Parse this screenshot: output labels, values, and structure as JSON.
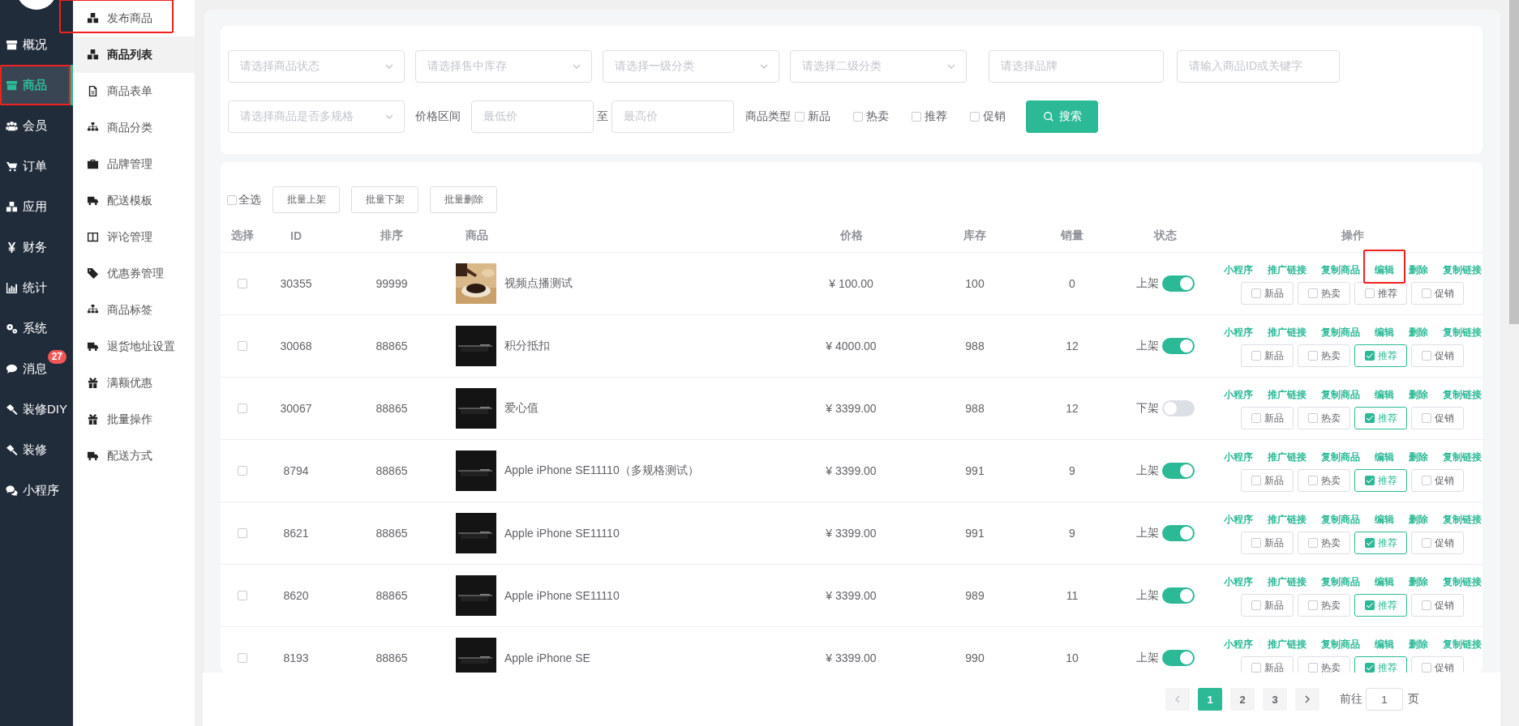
{
  "sidebar": {
    "items": [
      {
        "label": "概况",
        "selected": false,
        "annotated": false
      },
      {
        "label": "商品",
        "selected": true,
        "annotated": true
      },
      {
        "label": "会员",
        "selected": false,
        "annotated": false
      },
      {
        "label": "订单",
        "selected": false,
        "annotated": false
      },
      {
        "label": "应用",
        "selected": false,
        "annotated": false
      },
      {
        "label": "财务",
        "selected": false,
        "annotated": false
      },
      {
        "label": "统计",
        "selected": false,
        "annotated": false
      },
      {
        "label": "系统",
        "selected": false,
        "annotated": false
      },
      {
        "label": "消息",
        "selected": false,
        "annotated": false,
        "badge": "27"
      },
      {
        "label": "装修DIY",
        "selected": false,
        "annotated": false
      },
      {
        "label": "装修",
        "selected": false,
        "annotated": false
      },
      {
        "label": "小程序",
        "selected": false,
        "annotated": false
      }
    ]
  },
  "submenu": {
    "items": [
      {
        "label": "发布商品",
        "selected": false,
        "annotated": true
      },
      {
        "label": "商品列表",
        "selected": true,
        "annotated": false
      },
      {
        "label": "商品表单",
        "selected": false,
        "annotated": false
      },
      {
        "label": "商品分类",
        "selected": false,
        "annotated": false
      },
      {
        "label": "品牌管理",
        "selected": false,
        "annotated": false
      },
      {
        "label": "配送模板",
        "selected": false,
        "annotated": false
      },
      {
        "label": "评论管理",
        "selected": false,
        "annotated": false
      },
      {
        "label": "优惠券管理",
        "selected": false,
        "annotated": false
      },
      {
        "label": "商品标签",
        "selected": false,
        "annotated": false
      },
      {
        "label": "退货地址设置",
        "selected": false,
        "annotated": false
      },
      {
        "label": "满额优惠",
        "selected": false,
        "annotated": false
      },
      {
        "label": "批量操作",
        "selected": false,
        "annotated": false
      },
      {
        "label": "配送方式",
        "selected": false,
        "annotated": false
      }
    ]
  },
  "filters": {
    "fields": [
      {
        "kind": "select",
        "placeholder": "请选择商品状态"
      },
      {
        "kind": "select",
        "placeholder": "请选择售中库存"
      },
      {
        "kind": "select",
        "placeholder": "请选择一级分类"
      },
      {
        "kind": "select",
        "placeholder": "请选择二级分类"
      },
      {
        "kind": "input",
        "placeholder": "请选择品牌"
      },
      {
        "kind": "input",
        "placeholder": "请输入商品ID或关键字"
      }
    ],
    "spec_select": {
      "placeholder": "请选择商品是否多规格"
    },
    "price_label": "价格区间",
    "min_placeholder": "最低价",
    "separator": "至",
    "max_placeholder": "最高价",
    "type_label": "商品类型",
    "types": [
      {
        "label": "新品",
        "checked": false
      },
      {
        "label": "热卖",
        "checked": false
      },
      {
        "label": "推荐",
        "checked": false
      },
      {
        "label": "促销",
        "checked": false
      }
    ],
    "search_button": "搜索"
  },
  "bulk": {
    "select_all": {
      "label": "全选",
      "checked": false
    },
    "buttons": [
      "批量上架",
      "批量下架",
      "批量删除"
    ]
  },
  "table": {
    "columns": [
      "选择",
      "ID",
      "排序",
      "商品",
      "价格",
      "库存",
      "销量",
      "状态",
      "操作"
    ],
    "rows": [
      {
        "checked": false,
        "id": "30355",
        "sort": "99999",
        "thumb": {
          "kind": "picture"
        },
        "name": "视频点播测试",
        "price": "¥ 100.00",
        "stock": "100",
        "sales": "0",
        "status": {
          "label": "上架",
          "on": true
        },
        "actions": [
          {
            "label": "小程序",
            "annotated": false
          },
          {
            "label": "推广链接",
            "annotated": false
          },
          {
            "label": "复制商品",
            "annotated": false
          },
          {
            "label": "编辑",
            "annotated": true
          },
          {
            "label": "删除",
            "annotated": false
          },
          {
            "label": "复制链接",
            "annotated": false
          }
        ],
        "tags": [
          {
            "label": "新品",
            "checked": false
          },
          {
            "label": "热卖",
            "checked": false
          },
          {
            "label": "推荐",
            "checked": false
          },
          {
            "label": "促销",
            "checked": false
          }
        ]
      },
      {
        "checked": false,
        "id": "30068",
        "sort": "88865",
        "thumb": {
          "kind": "picture"
        },
        "name": "积分抵扣",
        "price": "¥ 4000.00",
        "stock": "988",
        "sales": "12",
        "status": {
          "label": "上架",
          "on": true
        },
        "actions": [
          {
            "label": "小程序",
            "annotated": false
          },
          {
            "label": "推广链接",
            "annotated": false
          },
          {
            "label": "复制商品",
            "annotated": false
          },
          {
            "label": "编辑",
            "annotated": false
          },
          {
            "label": "删除",
            "annotated": false
          },
          {
            "label": "复制链接",
            "annotated": false
          }
        ],
        "tags": [
          {
            "label": "新品",
            "checked": false
          },
          {
            "label": "热卖",
            "checked": false
          },
          {
            "label": "推荐",
            "checked": true
          },
          {
            "label": "促销",
            "checked": false
          }
        ]
      },
      {
        "checked": false,
        "id": "30067",
        "sort": "88865",
        "thumb": {
          "kind": "picture"
        },
        "name": "爱心值",
        "price": "¥ 3399.00",
        "stock": "988",
        "sales": "12",
        "status": {
          "label": "下架",
          "on": false
        },
        "actions": [
          {
            "label": "小程序",
            "annotated": false
          },
          {
            "label": "推广链接",
            "annotated": false
          },
          {
            "label": "复制商品",
            "annotated": false
          },
          {
            "label": "编辑",
            "annotated": false
          },
          {
            "label": "删除",
            "annotated": false
          },
          {
            "label": "复制链接",
            "annotated": false
          }
        ],
        "tags": [
          {
            "label": "新品",
            "checked": false
          },
          {
            "label": "热卖",
            "checked": false
          },
          {
            "label": "推荐",
            "checked": true
          },
          {
            "label": "促销",
            "checked": false
          }
        ]
      },
      {
        "checked": false,
        "id": "8794",
        "sort": "88865",
        "thumb": {
          "kind": "picture"
        },
        "name": "Apple iPhone SE11110（多规格测试）",
        "price": "¥ 3399.00",
        "stock": "991",
        "sales": "9",
        "status": {
          "label": "上架",
          "on": true
        },
        "actions": [
          {
            "label": "小程序",
            "annotated": false
          },
          {
            "label": "推广链接",
            "annotated": false
          },
          {
            "label": "复制商品",
            "annotated": false
          },
          {
            "label": "编辑",
            "annotated": false
          },
          {
            "label": "删除",
            "annotated": false
          },
          {
            "label": "复制链接",
            "annotated": false
          }
        ],
        "tags": [
          {
            "label": "新品",
            "checked": false
          },
          {
            "label": "热卖",
            "checked": false
          },
          {
            "label": "推荐",
            "checked": true
          },
          {
            "label": "促销",
            "checked": false
          }
        ]
      },
      {
        "checked": false,
        "id": "8621",
        "sort": "88865",
        "thumb": {
          "kind": "picture"
        },
        "name": "Apple iPhone SE11110",
        "price": "¥ 3399.00",
        "stock": "991",
        "sales": "9",
        "status": {
          "label": "上架",
          "on": true
        },
        "actions": [
          {
            "label": "小程序",
            "annotated": false
          },
          {
            "label": "推广链接",
            "annotated": false
          },
          {
            "label": "复制商品",
            "annotated": false
          },
          {
            "label": "编辑",
            "annotated": false
          },
          {
            "label": "删除",
            "annotated": false
          },
          {
            "label": "复制链接",
            "annotated": false
          }
        ],
        "tags": [
          {
            "label": "新品",
            "checked": false
          },
          {
            "label": "热卖",
            "checked": false
          },
          {
            "label": "推荐",
            "checked": true
          },
          {
            "label": "促销",
            "checked": false
          }
        ]
      },
      {
        "checked": false,
        "id": "8620",
        "sort": "88865",
        "thumb": {
          "kind": "picture"
        },
        "name": "Apple iPhone SE11110",
        "price": "¥ 3399.00",
        "stock": "989",
        "sales": "11",
        "status": {
          "label": "上架",
          "on": true
        },
        "actions": [
          {
            "label": "小程序",
            "annotated": false
          },
          {
            "label": "推广链接",
            "annotated": false
          },
          {
            "label": "复制商品",
            "annotated": false
          },
          {
            "label": "编辑",
            "annotated": false
          },
          {
            "label": "删除",
            "annotated": false
          },
          {
            "label": "复制链接",
            "annotated": false
          }
        ],
        "tags": [
          {
            "label": "新品",
            "checked": false
          },
          {
            "label": "热卖",
            "checked": false
          },
          {
            "label": "推荐",
            "checked": true
          },
          {
            "label": "促销",
            "checked": false
          }
        ]
      },
      {
        "checked": false,
        "id": "8193",
        "sort": "88865",
        "thumb": {
          "kind": "picture"
        },
        "name": "Apple iPhone SE",
        "price": "¥ 3399.00",
        "stock": "990",
        "sales": "10",
        "status": {
          "label": "上架",
          "on": true
        },
        "actions": [
          {
            "label": "小程序",
            "annotated": false
          },
          {
            "label": "推广链接",
            "annotated": false
          },
          {
            "label": "复制商品",
            "annotated": false
          },
          {
            "label": "编辑",
            "annotated": false
          },
          {
            "label": "删除",
            "annotated": false
          },
          {
            "label": "复制链接",
            "annotated": false
          }
        ],
        "tags": [
          {
            "label": "新品",
            "checked": false
          },
          {
            "label": "热卖",
            "checked": false
          },
          {
            "label": "推荐",
            "checked": true
          },
          {
            "label": "促销",
            "checked": false
          }
        ]
      }
    ]
  },
  "pagination": {
    "prev_disabled": true,
    "pages": [
      {
        "label": "1",
        "selected": true
      },
      {
        "label": "2",
        "selected": false
      },
      {
        "label": "3",
        "selected": false
      }
    ],
    "goto_label": "前往",
    "goto_value": "1",
    "page_suffix": "页"
  }
}
